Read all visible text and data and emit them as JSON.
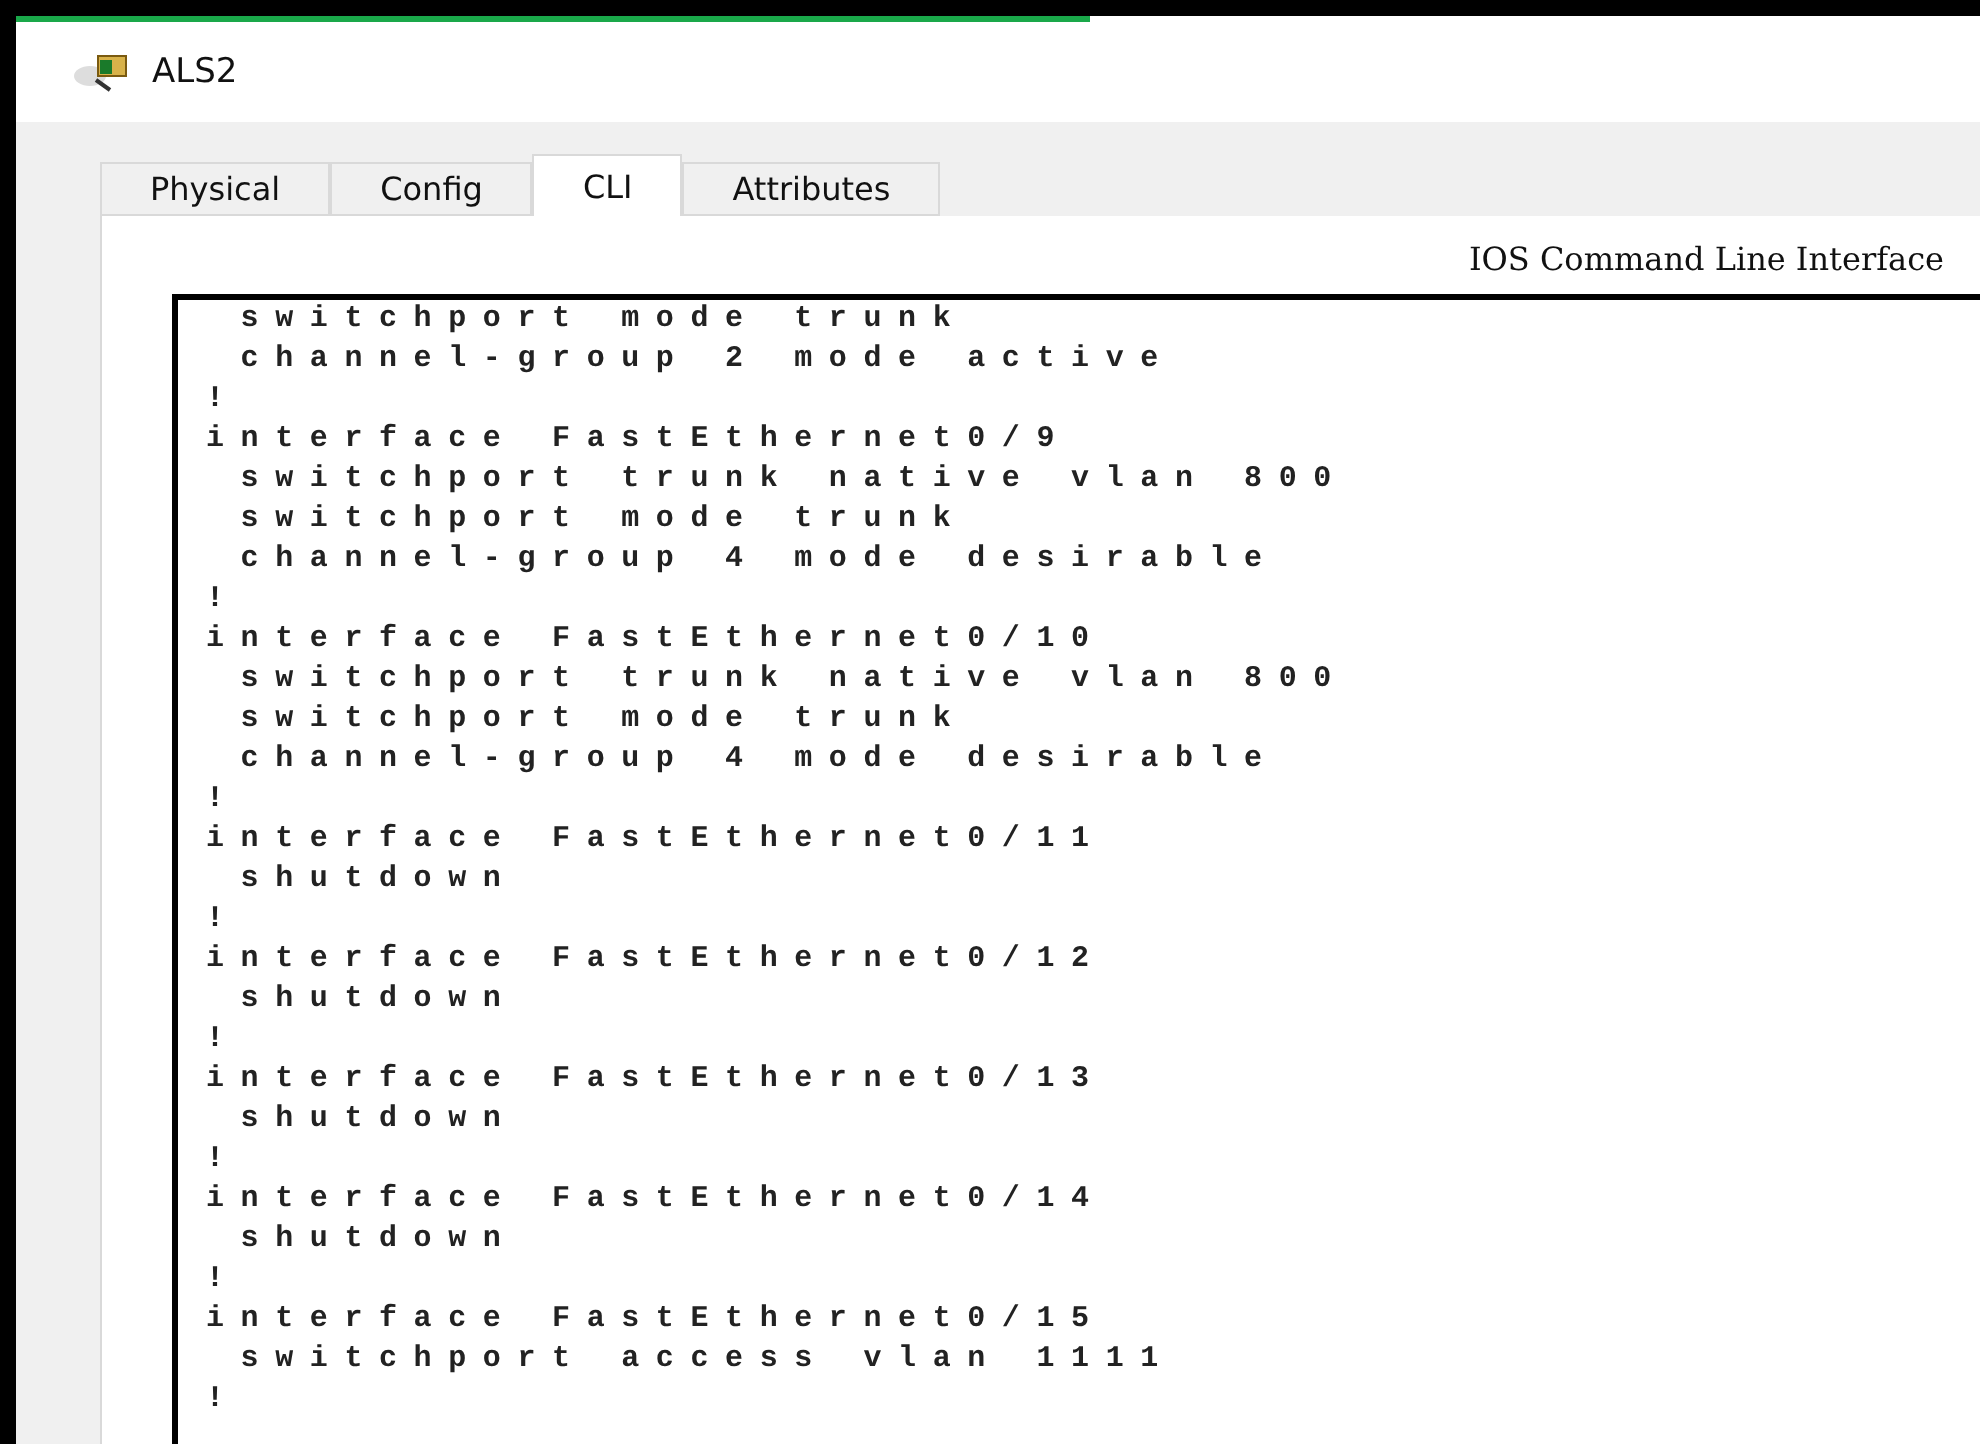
{
  "window": {
    "title": "ALS2"
  },
  "tabs": [
    {
      "label": "Physical",
      "selected": false
    },
    {
      "label": "Config",
      "selected": false
    },
    {
      "label": "CLI",
      "selected": true
    },
    {
      "label": "Attributes",
      "selected": false
    }
  ],
  "cli": {
    "heading": "IOS Command Line Interface",
    "lines": [
      " switchport mode trunk",
      " channel-group 2 mode active",
      "!",
      "interface FastEthernet0/9",
      " switchport trunk native vlan 800",
      " switchport mode trunk",
      " channel-group 4 mode desirable",
      "!",
      "interface FastEthernet0/10",
      " switchport trunk native vlan 800",
      " switchport mode trunk",
      " channel-group 4 mode desirable",
      "!",
      "interface FastEthernet0/11",
      " shutdown",
      "!",
      "interface FastEthernet0/12",
      " shutdown",
      "!",
      "interface FastEthernet0/13",
      " shutdown",
      "!",
      "interface FastEthernet0/14",
      " shutdown",
      "!",
      "interface FastEthernet0/15",
      " switchport access vlan 1111",
      "!"
    ]
  }
}
